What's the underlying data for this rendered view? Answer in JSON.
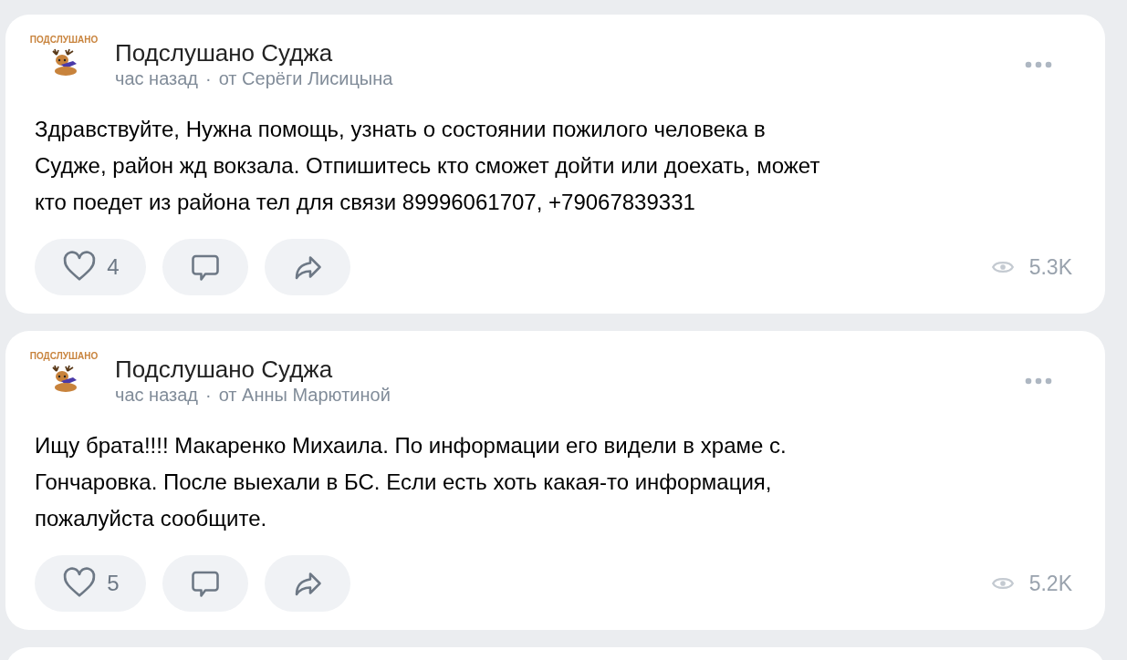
{
  "posts": [
    {
      "logo_text": "ПОДСЛУШАНО",
      "author": "Подслушано Суджа",
      "time": "час назад",
      "separator": "·",
      "from": "от Серёги Лисицына",
      "text": "Здравствуйте, Нужна помощь, узнать о состоянии пожилого человека в\nСудже, район жд вокзала. Отпишитесь кто сможет дойти или доехать, может\nкто поедет из района тел для связи 89996061707, +79067839331",
      "likes": "4",
      "views": "5.3K"
    },
    {
      "logo_text": "ПОДСЛУШАНО",
      "author": "Подслушано Суджа",
      "time": "час назад",
      "separator": "·",
      "from": "от Анны Марютиной",
      "text": "Ищу брата!!!! Макаренко Михаила. По информации его видели в храме с.\nГончаровка. После выехали в БС. Если есть хоть какая-то информация,\nпожалуйста сообщите.",
      "likes": "5",
      "views": "5.2K"
    }
  ]
}
